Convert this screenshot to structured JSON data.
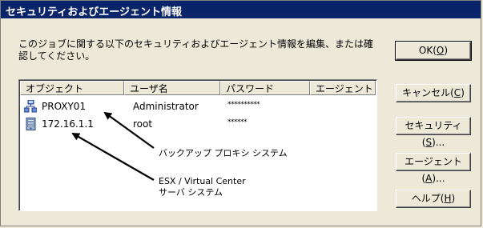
{
  "window": {
    "title": "セキュリティおよびエージェント情報"
  },
  "description": {
    "line1": "このジョブに関する以下のセキュリティおよびエージェント情報を編集、または確",
    "line2": "認してください。"
  },
  "list": {
    "columns": [
      "オブジェクト",
      "ユーザ名",
      "パスワード",
      "エージェント"
    ],
    "rows": [
      {
        "object": "PROXY01",
        "icon": "network-computer-icon",
        "user": "Administrator",
        "password": "**********",
        "agent": ""
      },
      {
        "object": "172.16.1.1",
        "icon": "server-icon",
        "user": "root",
        "password": "******",
        "agent": ""
      }
    ]
  },
  "annotations": {
    "proxy": "バックアップ プロキシ システム",
    "esx_line1": "ESX / Virtual Center",
    "esx_line2": "サーバ システム"
  },
  "buttons": {
    "ok": {
      "prefix": "OK(",
      "mnemonic": "O",
      "suffix": ")"
    },
    "cancel": {
      "prefix": "キャンセル(",
      "mnemonic": "C",
      "suffix": ")"
    },
    "security": {
      "prefix": "セキュリティ(",
      "mnemonic": "S",
      "suffix": ")..."
    },
    "agent": {
      "prefix": "エージェント(",
      "mnemonic": "A",
      "suffix": ")..."
    },
    "help": {
      "prefix": "ヘルプ(",
      "mnemonic": "H",
      "suffix": ")"
    }
  },
  "colors": {
    "title_bar": "#0a246a",
    "dialog_bg": "#ece9d8"
  }
}
